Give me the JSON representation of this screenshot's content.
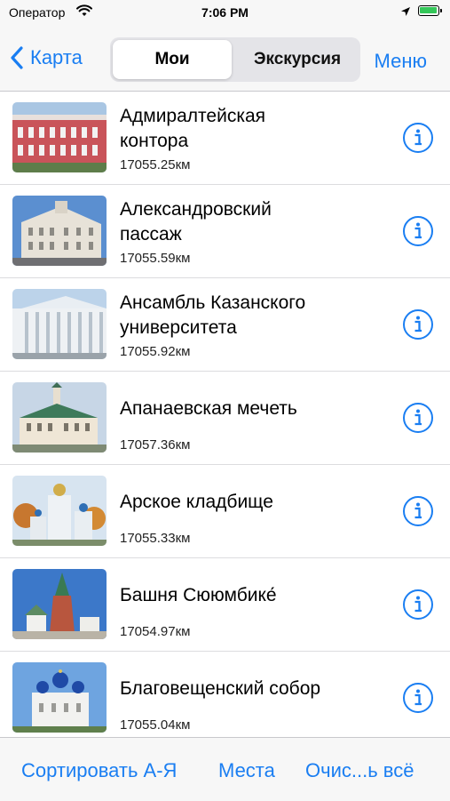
{
  "status_bar": {
    "carrier": "Оператор",
    "time": "7:06 PM"
  },
  "nav": {
    "back_label": "Карта",
    "segments": [
      "Мои",
      "Экскурсия"
    ],
    "menu_label": "Меню"
  },
  "places": [
    {
      "title_line1": "Адмиралтейская",
      "title_line2": "контора",
      "distance": "17055.25км"
    },
    {
      "title_line1": "Александровский",
      "title_line2": "пассаж",
      "distance": "17055.59км"
    },
    {
      "title_line1": "Ансамбль Казанского",
      "title_line2": "университета",
      "distance": "17055.92км"
    },
    {
      "title_line1": "Апанаевская мечеть",
      "title_line2": "",
      "distance": "17057.36км"
    },
    {
      "title_line1": "Арское кладбище",
      "title_line2": "",
      "distance": "17055.33км"
    },
    {
      "title_line1": "Башня Сююмбике́",
      "title_line2": "",
      "distance": "17054.97км"
    },
    {
      "title_line1": "Благовещенский собор",
      "title_line2": "",
      "distance": "17055.04км"
    }
  ],
  "toolbar": {
    "sort_label": "Сортировать А-Я",
    "places_label": "Места",
    "clear_label": "Очис...ь всё"
  },
  "colors": {
    "accent": "#1a7ef2",
    "battery": "#34c759"
  }
}
